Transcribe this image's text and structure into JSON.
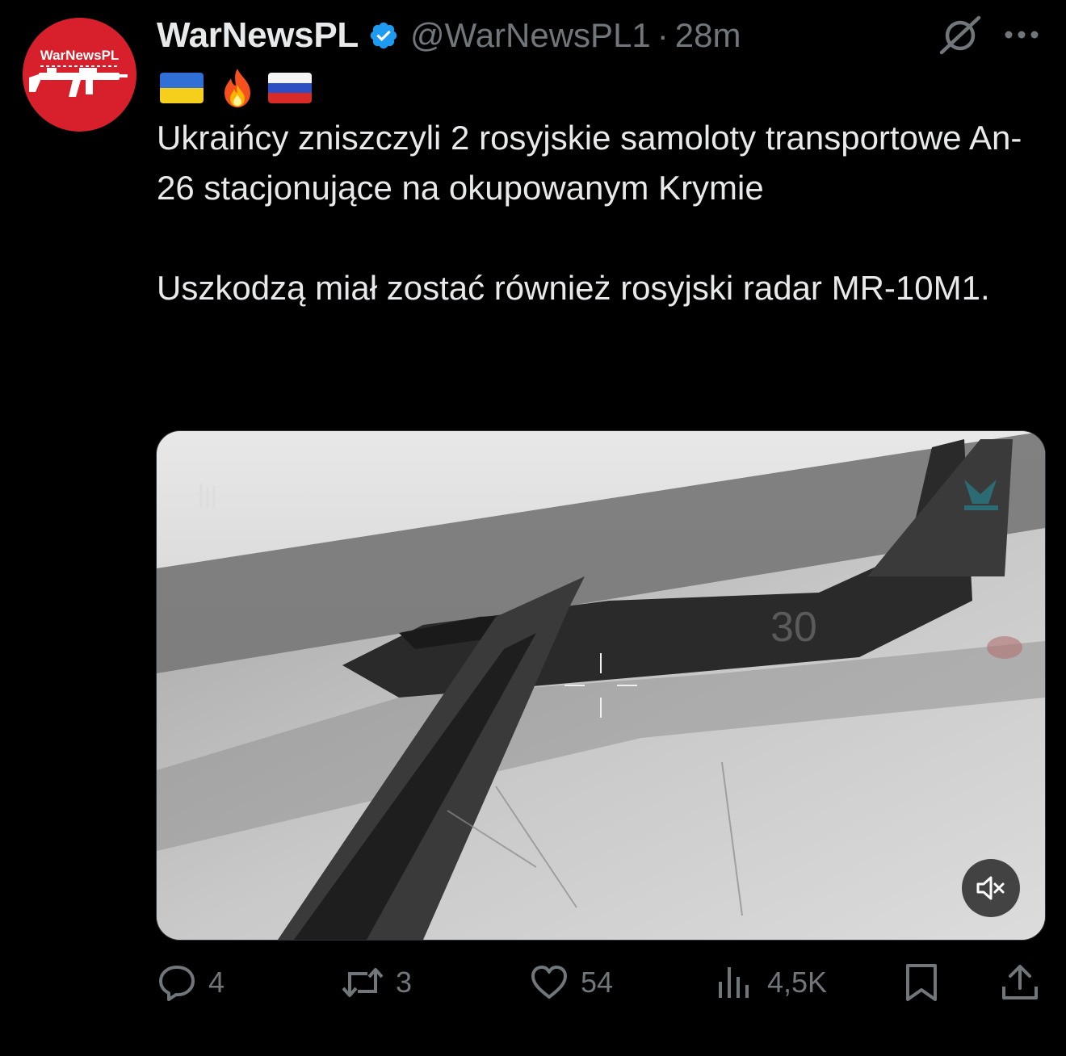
{
  "author": {
    "display_name": "WarNewsPL",
    "handle": "@WarNewsPL1",
    "separator": "·",
    "time": "28m",
    "avatar_text": "WarNewsPL",
    "verified_icon": "verified-badge-icon",
    "avatar_color": "#d7202b",
    "verified_color": "#1d9bf0"
  },
  "flags": [
    "ukraine-flag",
    "fire-emoji",
    "russia-flag"
  ],
  "tweet": {
    "paragraph_1": "Ukraińcy zniszczyli 2 rosyjskie samoloty transportowe An-26 stacjonujące na okupowanym Krymie",
    "paragraph_2": "Uszkodzą miał zostać również  rosyjski radar MR-10M1."
  },
  "media": {
    "type": "video",
    "overlay_text": "30",
    "mute_icon": "muted-speaker-icon"
  },
  "actions": {
    "replies": "4",
    "reposts": "3",
    "likes": "54",
    "views": "4,5K"
  },
  "colors": {
    "background": "#000000",
    "text_primary": "#e7e9ea",
    "text_secondary": "#71767b",
    "border": "#2f3336"
  }
}
